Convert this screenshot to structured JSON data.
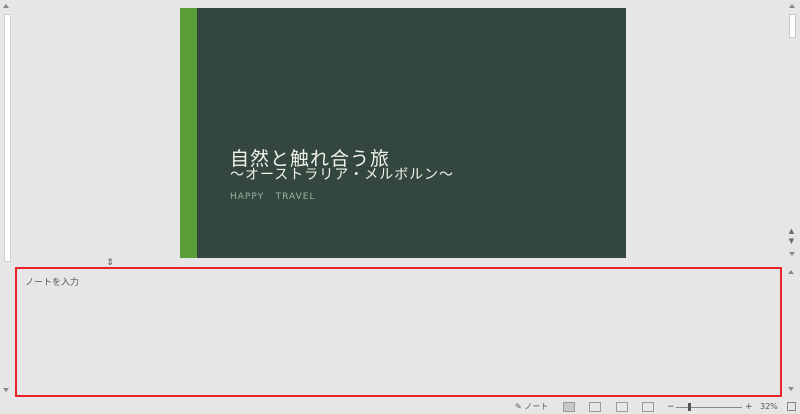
{
  "slide": {
    "title": "自然と触れ合う旅",
    "subtitle": "〜オーストラリア・メルボルン〜",
    "tag": "HAPPY   TRAVEL",
    "colors": {
      "background": "#33473e",
      "accent": "#5a9e3a"
    }
  },
  "notes": {
    "placeholder": "ノートを入力",
    "highlight_color": "#e8232b"
  },
  "statusbar": {
    "notes_label": "ノート",
    "zoom_minus": "−",
    "zoom_plus": "+",
    "zoom_level": "32%",
    "views": [
      "normal-view",
      "slide-sorter-view",
      "reading-view",
      "slide-show-view"
    ]
  }
}
